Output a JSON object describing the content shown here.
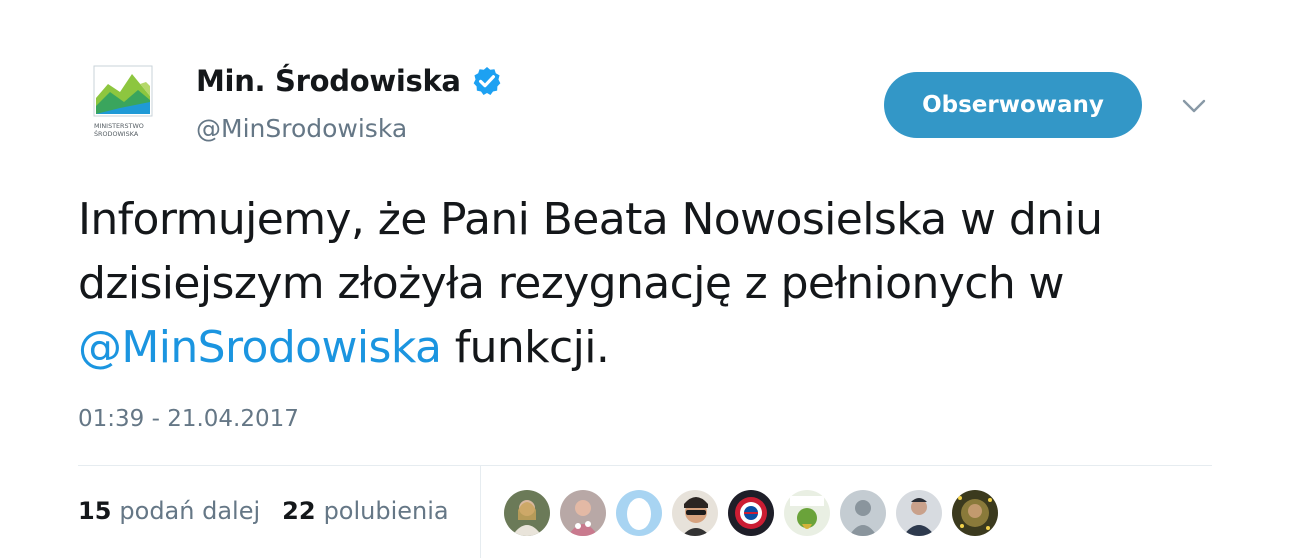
{
  "user": {
    "display_name": "Min. Środowiska",
    "handle": "@MinSrodowiska",
    "avatar_text": [
      "MINISTERSTWO",
      "ŚRODOWISKA"
    ],
    "verified_icon": "verified-badge-icon"
  },
  "follow_button": {
    "label": "Obserwowany",
    "color": "#3397c7"
  },
  "menu_icon": "chevron-down-icon",
  "tweet": {
    "text_before": "Informujemy, że Pani Beata Nowosielska w dniu dzisiejszym złożyła rezygnację z pełnionych w ",
    "mention": "@MinSrodowiska",
    "text_after": " funkcji.",
    "timestamp": "01:39 - 21.04.2017"
  },
  "stats": {
    "retweets_count": "15",
    "retweets_label": "podań dalej",
    "likes_count": "22",
    "likes_label": "polubienia"
  },
  "likers": [
    {
      "name": "liker-avatar-1"
    },
    {
      "name": "liker-avatar-2"
    },
    {
      "name": "liker-avatar-3"
    },
    {
      "name": "liker-avatar-4"
    },
    {
      "name": "liker-avatar-5"
    },
    {
      "name": "liker-avatar-6"
    },
    {
      "name": "liker-avatar-7"
    },
    {
      "name": "liker-avatar-8"
    },
    {
      "name": "liker-avatar-9"
    }
  ],
  "colors": {
    "text": "#14171a",
    "secondary": "#657786",
    "link": "#1b95e0",
    "verified": "#1da1f2"
  }
}
